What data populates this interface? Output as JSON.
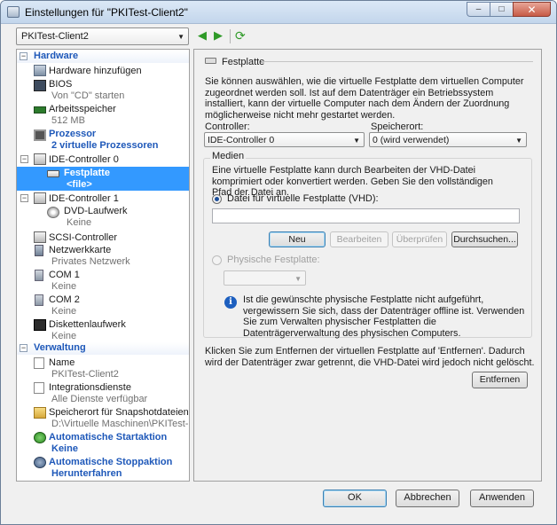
{
  "window": {
    "title": "Einstellungen für \"PKITest-Client2\"",
    "buttons": {
      "minimize": "–",
      "maximize": "□",
      "close": "✕"
    }
  },
  "vm_selector": {
    "value": "PKITest-Client2"
  },
  "toolbar": {
    "back": "◀",
    "forward": "▶",
    "refresh": "⟳"
  },
  "sidebar": {
    "hardware": {
      "label": "Hardware",
      "items": [
        {
          "name": "Hardware hinzufügen",
          "sub": ""
        },
        {
          "name": "BIOS",
          "sub": "Von \"CD\" starten"
        },
        {
          "name": "Arbeitsspeicher",
          "sub": "512 MB"
        },
        {
          "name": "Prozessor",
          "sub": "2 virtuelle Prozessoren"
        },
        {
          "name": "IDE-Controller 0",
          "sub": ""
        },
        {
          "name": "Festplatte",
          "sub": "<file>"
        },
        {
          "name": "IDE-Controller 1",
          "sub": ""
        },
        {
          "name": "DVD-Laufwerk",
          "sub": "Keine"
        },
        {
          "name": "SCSI-Controller",
          "sub": ""
        },
        {
          "name": "Netzwerkkarte",
          "sub": "Privates Netzwerk"
        },
        {
          "name": "COM 1",
          "sub": "Keine"
        },
        {
          "name": "COM 2",
          "sub": "Keine"
        },
        {
          "name": "Diskettenlaufwerk",
          "sub": "Keine"
        }
      ]
    },
    "management": {
      "label": "Verwaltung",
      "items": [
        {
          "name": "Name",
          "sub": "PKITest-Client2"
        },
        {
          "name": "Integrationsdienste",
          "sub": "Alle Dienste verfügbar"
        },
        {
          "name": "Speicherort für Snapshotdateien",
          "sub": "D:\\Virtuelle Maschinen\\PKITest-Cli..."
        },
        {
          "name": "Automatische Startaktion",
          "sub": "Keine"
        },
        {
          "name": "Automatische Stoppaktion",
          "sub": "Herunterfahren"
        }
      ]
    }
  },
  "panel": {
    "title": "Festplatte",
    "description": "Sie können auswählen, wie die virtuelle Festplatte dem virtuellen Computer zugeordnet werden soll. Ist auf dem Datenträger ein Betriebssystem installiert, kann der virtuelle Computer nach dem Ändern der Zuordnung möglicherweise nicht mehr gestartet werden.",
    "controller_label": "Controller:",
    "controller_value": "IDE-Controller 0",
    "location_label": "Speicherort:",
    "location_value": "0 (wird verwendet)",
    "media": {
      "label": "Medien",
      "description": "Eine virtuelle Festplatte kann durch Bearbeiten der VHD-Datei komprimiert oder konvertiert werden. Geben Sie den vollständigen Pfad der Datei an.",
      "vhd_radio_label": "Datei für virtuelle Festplatte (VHD):",
      "vhd_path": "",
      "buttons": {
        "new": "Neu",
        "edit": "Bearbeiten",
        "inspect": "Überprüfen",
        "browse": "Durchsuchen..."
      },
      "physical_radio_label": "Physische Festplatte:",
      "physical_value": "",
      "info_text": "Ist die gewünschte physische Festplatte nicht aufgeführt, vergewissern Sie sich, dass der Datenträger offline ist. Verwenden Sie zum Verwalten physischer Festplatten die Datenträgerverwaltung des physischen Computers."
    },
    "remove_text": "Klicken Sie zum Entfernen der virtuellen Festplatte auf 'Entfernen'. Dadurch wird der Datenträger zwar getrennt, die VHD-Datei wird jedoch nicht gelöscht.",
    "remove_button": "Entfernen"
  },
  "footer": {
    "ok": "OK",
    "cancel": "Abbrechen",
    "apply": "Anwenden"
  },
  "colors": {
    "accent": "#1e58b9",
    "selection": "#3399ff",
    "nav_green": "#2f9a28"
  }
}
